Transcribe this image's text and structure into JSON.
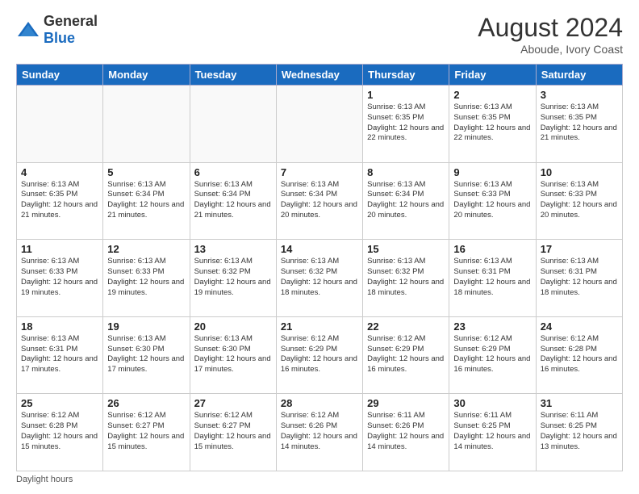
{
  "header": {
    "logo_general": "General",
    "logo_blue": "Blue",
    "month_year": "August 2024",
    "location": "Aboude, Ivory Coast"
  },
  "footer": {
    "note": "Daylight hours"
  },
  "weekdays": [
    "Sunday",
    "Monday",
    "Tuesday",
    "Wednesday",
    "Thursday",
    "Friday",
    "Saturday"
  ],
  "weeks": [
    [
      {
        "day": "",
        "content": ""
      },
      {
        "day": "",
        "content": ""
      },
      {
        "day": "",
        "content": ""
      },
      {
        "day": "",
        "content": ""
      },
      {
        "day": "1",
        "content": "Sunrise: 6:13 AM\nSunset: 6:35 PM\nDaylight: 12 hours\nand 22 minutes."
      },
      {
        "day": "2",
        "content": "Sunrise: 6:13 AM\nSunset: 6:35 PM\nDaylight: 12 hours\nand 22 minutes."
      },
      {
        "day": "3",
        "content": "Sunrise: 6:13 AM\nSunset: 6:35 PM\nDaylight: 12 hours\nand 21 minutes."
      }
    ],
    [
      {
        "day": "4",
        "content": "Sunrise: 6:13 AM\nSunset: 6:35 PM\nDaylight: 12 hours\nand 21 minutes."
      },
      {
        "day": "5",
        "content": "Sunrise: 6:13 AM\nSunset: 6:34 PM\nDaylight: 12 hours\nand 21 minutes."
      },
      {
        "day": "6",
        "content": "Sunrise: 6:13 AM\nSunset: 6:34 PM\nDaylight: 12 hours\nand 21 minutes."
      },
      {
        "day": "7",
        "content": "Sunrise: 6:13 AM\nSunset: 6:34 PM\nDaylight: 12 hours\nand 20 minutes."
      },
      {
        "day": "8",
        "content": "Sunrise: 6:13 AM\nSunset: 6:34 PM\nDaylight: 12 hours\nand 20 minutes."
      },
      {
        "day": "9",
        "content": "Sunrise: 6:13 AM\nSunset: 6:33 PM\nDaylight: 12 hours\nand 20 minutes."
      },
      {
        "day": "10",
        "content": "Sunrise: 6:13 AM\nSunset: 6:33 PM\nDaylight: 12 hours\nand 20 minutes."
      }
    ],
    [
      {
        "day": "11",
        "content": "Sunrise: 6:13 AM\nSunset: 6:33 PM\nDaylight: 12 hours\nand 19 minutes."
      },
      {
        "day": "12",
        "content": "Sunrise: 6:13 AM\nSunset: 6:33 PM\nDaylight: 12 hours\nand 19 minutes."
      },
      {
        "day": "13",
        "content": "Sunrise: 6:13 AM\nSunset: 6:32 PM\nDaylight: 12 hours\nand 19 minutes."
      },
      {
        "day": "14",
        "content": "Sunrise: 6:13 AM\nSunset: 6:32 PM\nDaylight: 12 hours\nand 18 minutes."
      },
      {
        "day": "15",
        "content": "Sunrise: 6:13 AM\nSunset: 6:32 PM\nDaylight: 12 hours\nand 18 minutes."
      },
      {
        "day": "16",
        "content": "Sunrise: 6:13 AM\nSunset: 6:31 PM\nDaylight: 12 hours\nand 18 minutes."
      },
      {
        "day": "17",
        "content": "Sunrise: 6:13 AM\nSunset: 6:31 PM\nDaylight: 12 hours\nand 18 minutes."
      }
    ],
    [
      {
        "day": "18",
        "content": "Sunrise: 6:13 AM\nSunset: 6:31 PM\nDaylight: 12 hours\nand 17 minutes."
      },
      {
        "day": "19",
        "content": "Sunrise: 6:13 AM\nSunset: 6:30 PM\nDaylight: 12 hours\nand 17 minutes."
      },
      {
        "day": "20",
        "content": "Sunrise: 6:13 AM\nSunset: 6:30 PM\nDaylight: 12 hours\nand 17 minutes."
      },
      {
        "day": "21",
        "content": "Sunrise: 6:12 AM\nSunset: 6:29 PM\nDaylight: 12 hours\nand 16 minutes."
      },
      {
        "day": "22",
        "content": "Sunrise: 6:12 AM\nSunset: 6:29 PM\nDaylight: 12 hours\nand 16 minutes."
      },
      {
        "day": "23",
        "content": "Sunrise: 6:12 AM\nSunset: 6:29 PM\nDaylight: 12 hours\nand 16 minutes."
      },
      {
        "day": "24",
        "content": "Sunrise: 6:12 AM\nSunset: 6:28 PM\nDaylight: 12 hours\nand 16 minutes."
      }
    ],
    [
      {
        "day": "25",
        "content": "Sunrise: 6:12 AM\nSunset: 6:28 PM\nDaylight: 12 hours\nand 15 minutes."
      },
      {
        "day": "26",
        "content": "Sunrise: 6:12 AM\nSunset: 6:27 PM\nDaylight: 12 hours\nand 15 minutes."
      },
      {
        "day": "27",
        "content": "Sunrise: 6:12 AM\nSunset: 6:27 PM\nDaylight: 12 hours\nand 15 minutes."
      },
      {
        "day": "28",
        "content": "Sunrise: 6:12 AM\nSunset: 6:26 PM\nDaylight: 12 hours\nand 14 minutes."
      },
      {
        "day": "29",
        "content": "Sunrise: 6:11 AM\nSunset: 6:26 PM\nDaylight: 12 hours\nand 14 minutes."
      },
      {
        "day": "30",
        "content": "Sunrise: 6:11 AM\nSunset: 6:25 PM\nDaylight: 12 hours\nand 14 minutes."
      },
      {
        "day": "31",
        "content": "Sunrise: 6:11 AM\nSunset: 6:25 PM\nDaylight: 12 hours\nand 13 minutes."
      }
    ]
  ]
}
